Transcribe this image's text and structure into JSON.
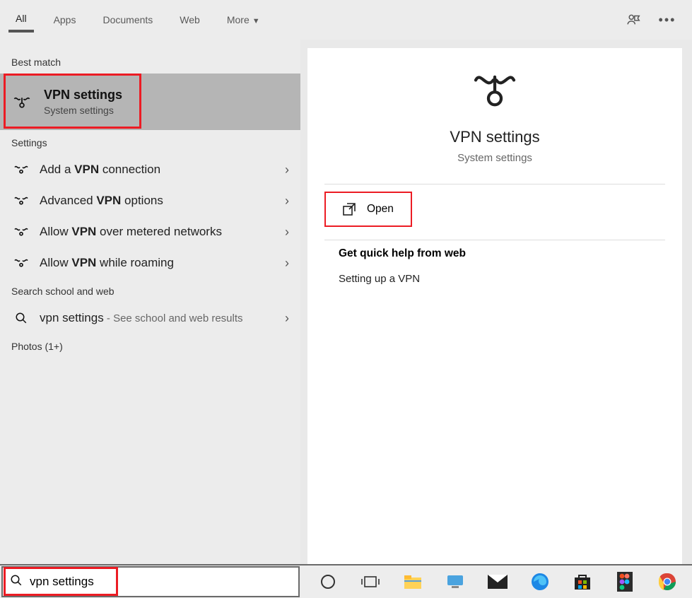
{
  "tabs": {
    "all": "All",
    "apps": "Apps",
    "documents": "Documents",
    "web": "Web",
    "more": "More"
  },
  "sections": {
    "best_match": "Best match",
    "settings": "Settings",
    "search_web": "Search school and web",
    "photos": "Photos (1+)"
  },
  "best_match_item": {
    "title": "VPN settings",
    "subtitle": "System settings"
  },
  "settings_items": [
    {
      "pre": "Add a ",
      "bold": "VPN",
      "post": " connection"
    },
    {
      "pre": "Advanced ",
      "bold": "VPN",
      "post": " options"
    },
    {
      "pre": "Allow ",
      "bold": "VPN",
      "post": " over metered networks"
    },
    {
      "pre": "Allow ",
      "bold": "VPN",
      "post": " while roaming"
    }
  ],
  "web_item": {
    "query": "vpn settings",
    "suffix": " - See school and web results"
  },
  "preview": {
    "title": "VPN settings",
    "subtitle": "System settings",
    "open": "Open",
    "help_title": "Get quick help from web",
    "help_link": "Setting up a VPN"
  },
  "search": {
    "value": "vpn settings"
  }
}
